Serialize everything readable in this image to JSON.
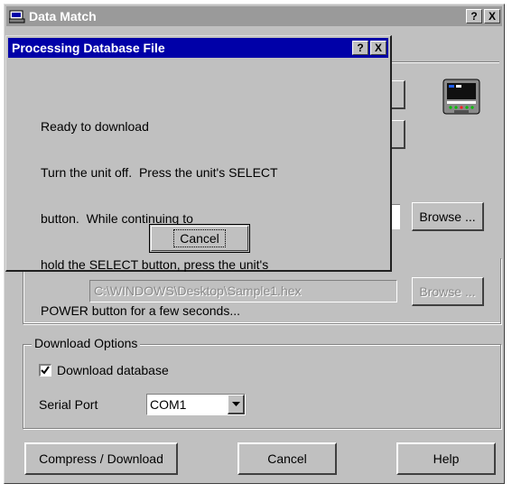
{
  "main_window": {
    "title": "Data Match",
    "help_btn": "?",
    "close_btn": "X"
  },
  "file_path": {
    "value": "C:\\WINDOWS\\Desktop\\Sample1.hex"
  },
  "browse_label": "Browse ...",
  "download_options": {
    "group_label": "Download Options",
    "checkbox_label": "Download database",
    "checked": true,
    "serial_port_label": "Serial Port",
    "serial_port_value": "COM1"
  },
  "buttons": {
    "compress_download": "Compress / Download",
    "cancel": "Cancel",
    "help": "Help"
  },
  "dialog": {
    "title": "Processing Database File",
    "help_btn": "?",
    "close_btn": "X",
    "message_lines": [
      "Ready to download",
      "Turn the unit off.  Press the unit's SELECT",
      "button.  While continuing to",
      "hold the SELECT button, press the unit's",
      "POWER button for a few seconds..."
    ],
    "cancel_label": "Cancel"
  }
}
